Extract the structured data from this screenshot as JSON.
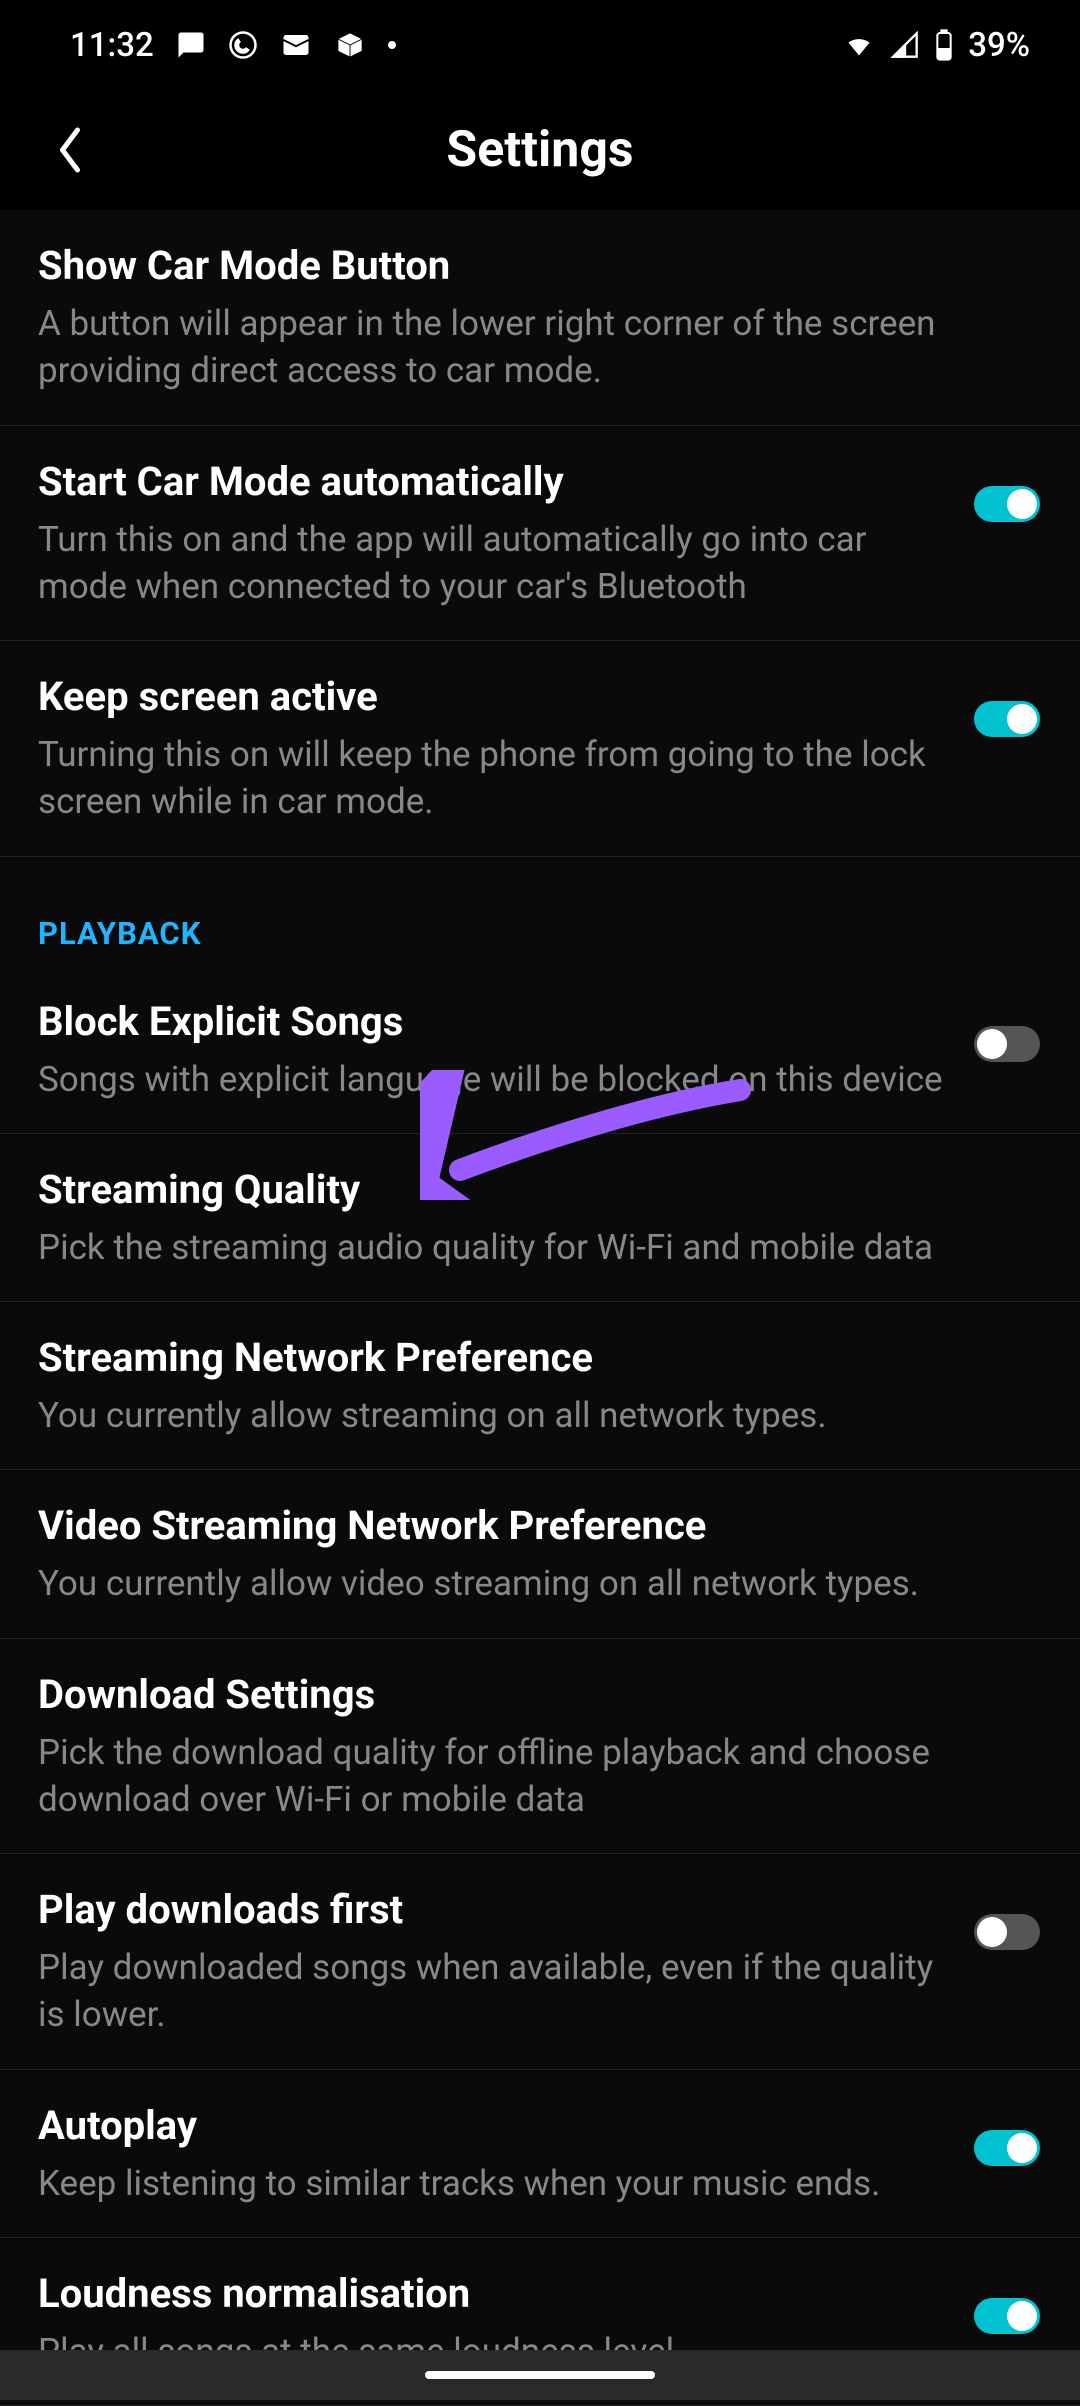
{
  "status_bar": {
    "time": "11:32",
    "battery_percent": "39%"
  },
  "header": {
    "title": "Settings"
  },
  "sections": [
    {
      "items": [
        {
          "title": "Show Car Mode Button",
          "desc": "A button will appear in the lower right corner of the screen providing direct access to car mode.",
          "toggle": null
        },
        {
          "title": "Start Car Mode automatically",
          "desc": "Turn this on and the app will automatically go into car mode when connected to your car's Bluetooth",
          "toggle": true
        },
        {
          "title": "Keep screen active",
          "desc": "Turning this on will keep the phone from going to the lock screen while in car mode.",
          "toggle": true
        }
      ]
    },
    {
      "header": "PLAYBACK",
      "items": [
        {
          "title": "Block Explicit Songs",
          "desc": "Songs with explicit language will be blocked on this device",
          "toggle": false
        },
        {
          "title": "Streaming Quality",
          "desc": "Pick the streaming audio quality for Wi-Fi and mobile data",
          "toggle": null
        },
        {
          "title": "Streaming Network Preference",
          "desc": "You currently allow streaming on all network types.",
          "toggle": null
        },
        {
          "title": "Video Streaming Network Preference",
          "desc": "You currently allow video streaming on all network types.",
          "toggle": null
        },
        {
          "title": "Download Settings",
          "desc": "Pick the download quality for offline playback and choose download over Wi-Fi or mobile data",
          "toggle": null
        },
        {
          "title": "Play downloads first",
          "desc": "Play downloaded songs when available, even if the quality is lower.",
          "toggle": false
        },
        {
          "title": "Autoplay",
          "desc": "Keep listening to similar tracks when your music ends.",
          "toggle": true
        },
        {
          "title": "Loudness normalisation",
          "desc": "Play all songs at the same loudness level",
          "toggle": true
        }
      ]
    }
  ]
}
